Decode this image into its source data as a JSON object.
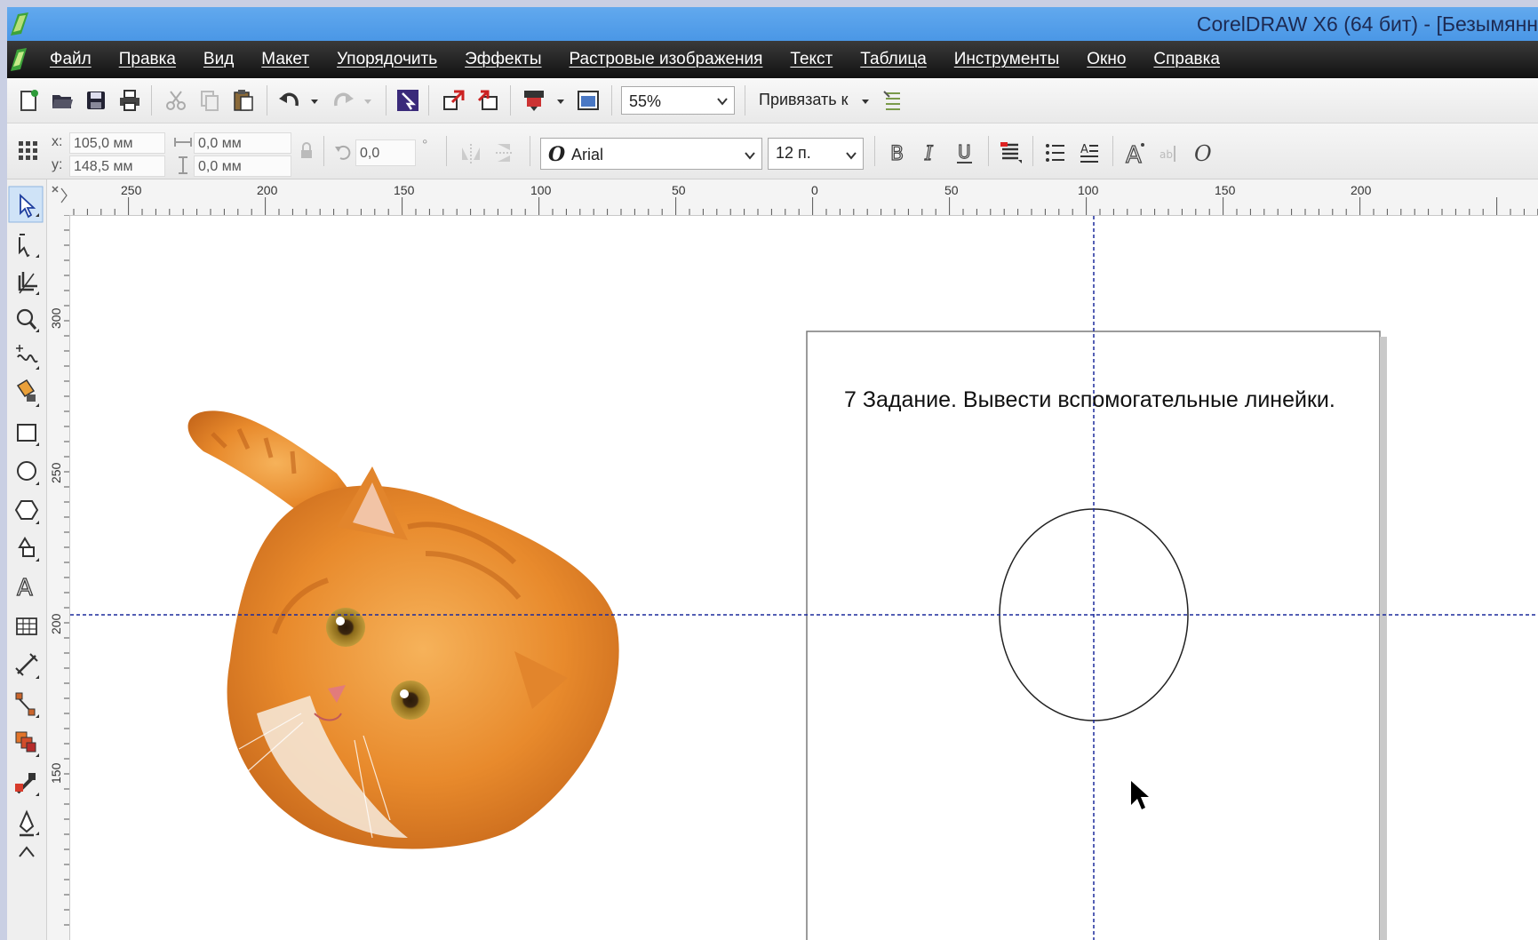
{
  "window": {
    "title": "CorelDRAW X6 (64 бит) - [Безымянн"
  },
  "menu": {
    "items": [
      "Файл",
      "Правка",
      "Вид",
      "Макет",
      "Упорядочить",
      "Эффекты",
      "Растровые изображения",
      "Текст",
      "Таблица",
      "Инструменты",
      "Окно",
      "Справка"
    ]
  },
  "toolbar": {
    "zoom_value": "55%",
    "snap_label": "Привязать к"
  },
  "property_bar": {
    "x_label": "x:",
    "x_value": "105,0 мм",
    "y_label": "y:",
    "y_value": "148,5 мм",
    "width_value": "0,0 мм",
    "height_value": "0,0 мм",
    "rotation_value": "0,0",
    "degree_symbol": "°",
    "font_name": "Arial",
    "font_size": "12 п."
  },
  "rulers": {
    "horizontal_labels": [
      "250",
      "200",
      "150",
      "100",
      "50",
      "0",
      "50",
      "100",
      "150",
      "200"
    ],
    "vertical_labels": [
      "300",
      "250",
      "200",
      "150"
    ]
  },
  "document": {
    "instruction_text": "7 Задание. Вывести вспомогательные линейки."
  },
  "colors": {
    "titlebar": "#4a97e6",
    "menubar": "#1a1a1a",
    "guideline": "#1c2a9c",
    "cat_fur": "#e88a2c"
  },
  "icons": {
    "toolbox": [
      "pick-tool-icon",
      "shape-tool-icon",
      "crop-tool-icon",
      "zoom-tool-icon",
      "freehand-tool-icon",
      "smart-fill-icon",
      "rectangle-tool-icon",
      "ellipse-tool-icon",
      "polygon-tool-icon",
      "basic-shapes-icon",
      "text-tool-icon",
      "table-tool-icon",
      "dimension-tool-icon",
      "connector-tool-icon",
      "blend-tool-icon",
      "eyedropper-tool-icon",
      "outline-pen-icon",
      "fill-tool-icon"
    ]
  }
}
